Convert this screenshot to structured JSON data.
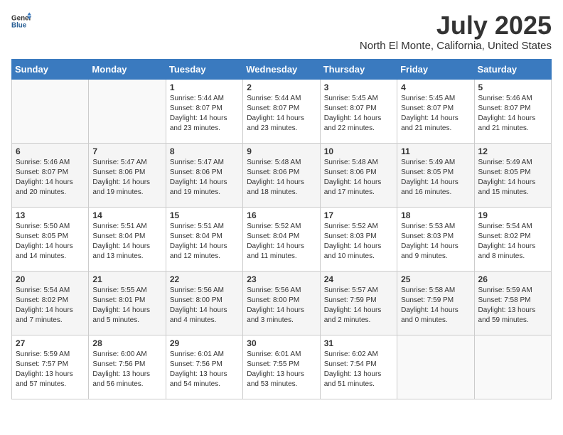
{
  "header": {
    "logo_general": "General",
    "logo_blue": "Blue",
    "title": "July 2025",
    "subtitle": "North El Monte, California, United States"
  },
  "calendar": {
    "columns": [
      "Sunday",
      "Monday",
      "Tuesday",
      "Wednesday",
      "Thursday",
      "Friday",
      "Saturday"
    ],
    "rows": [
      [
        {
          "day": "",
          "info": ""
        },
        {
          "day": "",
          "info": ""
        },
        {
          "day": "1",
          "info": "Sunrise: 5:44 AM\nSunset: 8:07 PM\nDaylight: 14 hours and 23 minutes."
        },
        {
          "day": "2",
          "info": "Sunrise: 5:44 AM\nSunset: 8:07 PM\nDaylight: 14 hours and 23 minutes."
        },
        {
          "day": "3",
          "info": "Sunrise: 5:45 AM\nSunset: 8:07 PM\nDaylight: 14 hours and 22 minutes."
        },
        {
          "day": "4",
          "info": "Sunrise: 5:45 AM\nSunset: 8:07 PM\nDaylight: 14 hours and 21 minutes."
        },
        {
          "day": "5",
          "info": "Sunrise: 5:46 AM\nSunset: 8:07 PM\nDaylight: 14 hours and 21 minutes."
        }
      ],
      [
        {
          "day": "6",
          "info": "Sunrise: 5:46 AM\nSunset: 8:07 PM\nDaylight: 14 hours and 20 minutes."
        },
        {
          "day": "7",
          "info": "Sunrise: 5:47 AM\nSunset: 8:06 PM\nDaylight: 14 hours and 19 minutes."
        },
        {
          "day": "8",
          "info": "Sunrise: 5:47 AM\nSunset: 8:06 PM\nDaylight: 14 hours and 19 minutes."
        },
        {
          "day": "9",
          "info": "Sunrise: 5:48 AM\nSunset: 8:06 PM\nDaylight: 14 hours and 18 minutes."
        },
        {
          "day": "10",
          "info": "Sunrise: 5:48 AM\nSunset: 8:06 PM\nDaylight: 14 hours and 17 minutes."
        },
        {
          "day": "11",
          "info": "Sunrise: 5:49 AM\nSunset: 8:05 PM\nDaylight: 14 hours and 16 minutes."
        },
        {
          "day": "12",
          "info": "Sunrise: 5:49 AM\nSunset: 8:05 PM\nDaylight: 14 hours and 15 minutes."
        }
      ],
      [
        {
          "day": "13",
          "info": "Sunrise: 5:50 AM\nSunset: 8:05 PM\nDaylight: 14 hours and 14 minutes."
        },
        {
          "day": "14",
          "info": "Sunrise: 5:51 AM\nSunset: 8:04 PM\nDaylight: 14 hours and 13 minutes."
        },
        {
          "day": "15",
          "info": "Sunrise: 5:51 AM\nSunset: 8:04 PM\nDaylight: 14 hours and 12 minutes."
        },
        {
          "day": "16",
          "info": "Sunrise: 5:52 AM\nSunset: 8:04 PM\nDaylight: 14 hours and 11 minutes."
        },
        {
          "day": "17",
          "info": "Sunrise: 5:52 AM\nSunset: 8:03 PM\nDaylight: 14 hours and 10 minutes."
        },
        {
          "day": "18",
          "info": "Sunrise: 5:53 AM\nSunset: 8:03 PM\nDaylight: 14 hours and 9 minutes."
        },
        {
          "day": "19",
          "info": "Sunrise: 5:54 AM\nSunset: 8:02 PM\nDaylight: 14 hours and 8 minutes."
        }
      ],
      [
        {
          "day": "20",
          "info": "Sunrise: 5:54 AM\nSunset: 8:02 PM\nDaylight: 14 hours and 7 minutes."
        },
        {
          "day": "21",
          "info": "Sunrise: 5:55 AM\nSunset: 8:01 PM\nDaylight: 14 hours and 5 minutes."
        },
        {
          "day": "22",
          "info": "Sunrise: 5:56 AM\nSunset: 8:00 PM\nDaylight: 14 hours and 4 minutes."
        },
        {
          "day": "23",
          "info": "Sunrise: 5:56 AM\nSunset: 8:00 PM\nDaylight: 14 hours and 3 minutes."
        },
        {
          "day": "24",
          "info": "Sunrise: 5:57 AM\nSunset: 7:59 PM\nDaylight: 14 hours and 2 minutes."
        },
        {
          "day": "25",
          "info": "Sunrise: 5:58 AM\nSunset: 7:59 PM\nDaylight: 14 hours and 0 minutes."
        },
        {
          "day": "26",
          "info": "Sunrise: 5:59 AM\nSunset: 7:58 PM\nDaylight: 13 hours and 59 minutes."
        }
      ],
      [
        {
          "day": "27",
          "info": "Sunrise: 5:59 AM\nSunset: 7:57 PM\nDaylight: 13 hours and 57 minutes."
        },
        {
          "day": "28",
          "info": "Sunrise: 6:00 AM\nSunset: 7:56 PM\nDaylight: 13 hours and 56 minutes."
        },
        {
          "day": "29",
          "info": "Sunrise: 6:01 AM\nSunset: 7:56 PM\nDaylight: 13 hours and 54 minutes."
        },
        {
          "day": "30",
          "info": "Sunrise: 6:01 AM\nSunset: 7:55 PM\nDaylight: 13 hours and 53 minutes."
        },
        {
          "day": "31",
          "info": "Sunrise: 6:02 AM\nSunset: 7:54 PM\nDaylight: 13 hours and 51 minutes."
        },
        {
          "day": "",
          "info": ""
        },
        {
          "day": "",
          "info": ""
        }
      ]
    ]
  }
}
